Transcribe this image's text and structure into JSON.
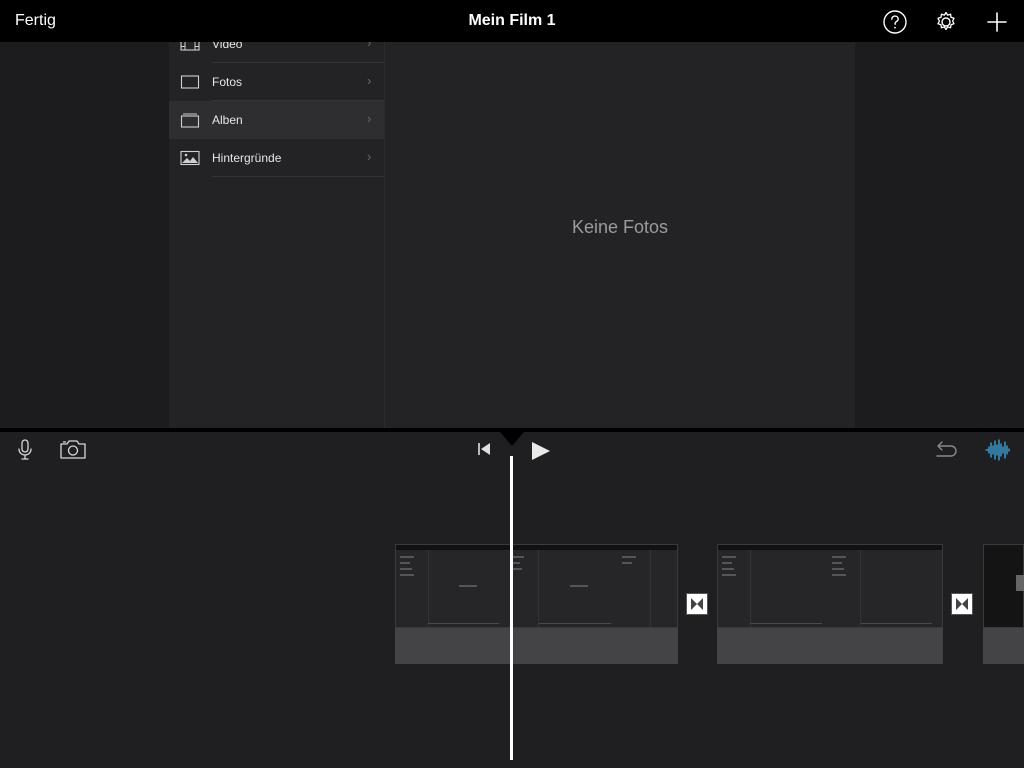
{
  "topbar": {
    "done_label": "Fertig",
    "title": "Mein Film 1",
    "help_icon": "help-icon",
    "settings_icon": "gear-icon",
    "add_icon": "plus-icon"
  },
  "sidebar": {
    "items": [
      {
        "label": "Video",
        "icon": "film-icon"
      },
      {
        "label": "Fotos",
        "icon": "photo-frame-icon"
      },
      {
        "label": "Alben",
        "icon": "album-icon",
        "selected": true
      },
      {
        "label": "Hintergründe",
        "icon": "landscape-icon"
      }
    ]
  },
  "content": {
    "empty_text": "Keine Fotos"
  },
  "timeline": {
    "mic_icon": "microphone-icon",
    "camera_icon": "camera-icon",
    "skip_back_icon": "skip-to-start-icon",
    "play_icon": "play-icon",
    "undo_icon": "undo-icon",
    "audio_icon": "audio-waveform-icon",
    "accent_color": "#3fa9e0"
  }
}
